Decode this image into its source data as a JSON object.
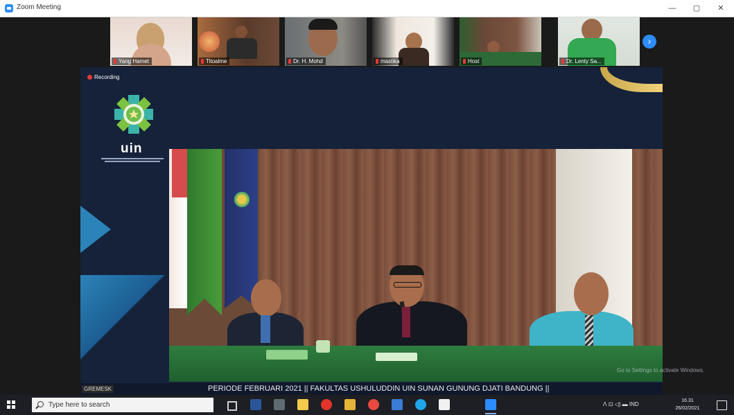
{
  "window": {
    "title": "Zoom Meeting",
    "minimize": "—",
    "maximize": "▢",
    "close": "✕"
  },
  "participants": [
    {
      "name": "Yang Hamet"
    },
    {
      "name": "Titoalme"
    },
    {
      "name": "Dr. H. Mohd"
    },
    {
      "name": "mastika"
    },
    {
      "name": "Host"
    },
    {
      "name": "Dr. Lenty Sa..."
    }
  ],
  "next_participants_icon": "chevron-right",
  "recording": {
    "label": "Recording"
  },
  "logo": {
    "word": "uin"
  },
  "signal_label": "GREMESK",
  "ticker": {
    "text": "PERIODE FEBRUARI 2021 || FAKULTAS USHULUDDIN UIN SUNAN GUNUNG DJATI BANDUNG ||"
  },
  "watermark": {
    "text": "Go to Settings to activate Windows."
  },
  "taskbar": {
    "search_placeholder": "Type here to search",
    "tray": "ᐱ  ⊡  ◁)  ▬  IND",
    "clock_time": "16.31",
    "clock_date": "26/02/2021"
  },
  "colors": {
    "zoom_blue": "#2d8cff",
    "slide_navy": "#15223a",
    "accent_gold": "#c8a64a",
    "table_green": "#2f7d3f"
  }
}
